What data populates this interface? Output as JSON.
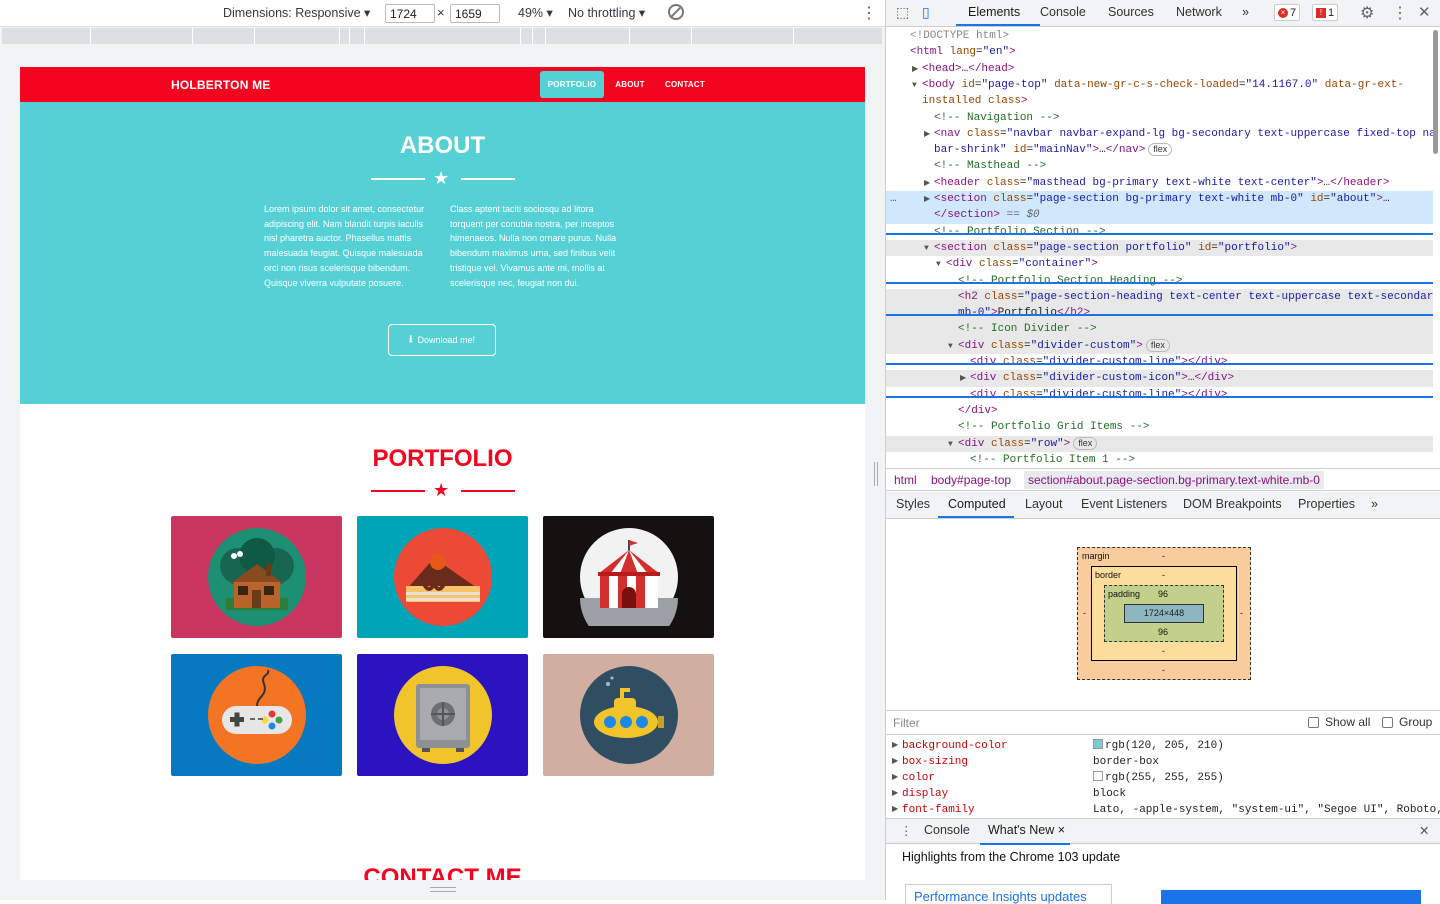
{
  "devbar": {
    "dimensions_label": "Dimensions: Responsive ▾",
    "width": "1724",
    "height": "1659",
    "times": "×",
    "zoom": "49% ▾",
    "throttle": "No throttling ▾",
    "more": "⋮"
  },
  "site": {
    "brand": "HOLBERTON ME",
    "nav": [
      "PORTFOLIO",
      "ABOUT",
      "CONTACT"
    ],
    "about_title": "ABOUT",
    "about_col1": "Lorem ipsum dolor sit amet, consectetur adipiscing elit. Nam blandit turpis iaculis nisl pharetra auctor. Phasellus mattis malesuada feugiat. Quisque malesuada orci non risus scelerisque bibendum. Quisque viverra vulputate posuere.",
    "about_col2": "Class aptent taciti sociosqu ad litora torquent per conubia nostra, per inceptos himenaeos. Nulla non ornare purus. Nulla bibendum maximus urna, sed finibus velit tristique vel. Vivamus ante mi, mollis at scelerisque nec, feugiat non dui.",
    "download_label": "Download me!",
    "portfolio_title": "PORTFOLIO",
    "contact_title": "CONTACT ME",
    "colors": {
      "red": "#f3041f",
      "teal": "#55d1d6"
    },
    "tiles": [
      {
        "name": "cabin",
        "bg": "#c9365f",
        "disc": "#1d8f73"
      },
      {
        "name": "cake",
        "bg": "#00a4b7",
        "disc": "#ec4a36"
      },
      {
        "name": "circus",
        "bg": "#151110",
        "disc": "#f2f2f2"
      },
      {
        "name": "game",
        "bg": "#0679c0",
        "disc": "#f37524"
      },
      {
        "name": "safe",
        "bg": "#2b13bf",
        "disc": "#f2c42b"
      },
      {
        "name": "submarine",
        "bg": "#d1afa0",
        "disc": "#2f4e62"
      }
    ]
  },
  "devtools": {
    "tabs": [
      "Elements",
      "Console",
      "Sources",
      "Network",
      "»"
    ],
    "errors": "7",
    "warnings": "1",
    "dom_lines": [
      {
        "i": 0,
        "html": "<span class='cmt' style='color:#888'>&lt;!DOCTYPE html&gt;</span>"
      },
      {
        "i": 0,
        "html": "<span class='tag'>&lt;html</span> <span class='attr'>lang</span>=<span class='val'>\"en\"</span><span class='tag'>&gt;</span>"
      },
      {
        "i": 1,
        "t": "▶",
        "html": "<span class='tag'>&lt;head&gt;</span>…<span class='tag'>&lt;/head&gt;</span>"
      },
      {
        "i": 1,
        "t": "▼",
        "html": "<span class='tag'>&lt;body</span> <span class='attr'>id</span>=<span class='val'>\"page-top\"</span> <span class='attr'>data-new-gr-c-s-check-loaded</span>=<span class='val'>\"14.1167.0\"</span> <span class='attr'>data-gr-ext-</span>"
      },
      {
        "i": 1,
        "html": "<span class='attr'>installed</span> <span class='attr'>class</span><span class='tag'>&gt;</span>"
      },
      {
        "i": 2,
        "html": "<span class='cmt'>&lt;!-- Navigation --&gt;</span>"
      },
      {
        "i": 2,
        "t": "▶",
        "html": "<span class='tag'>&lt;nav</span> <span class='attr'>class</span>=<span class='val'>\"navbar navbar-expand-lg bg-secondary text-uppercase fixed-top nav</span>"
      },
      {
        "i": 2,
        "html": "<span class='val'>bar-shrink\"</span> <span class='attr'>id</span>=<span class='val'>\"mainNav\"</span><span class='tag'>&gt;</span>…<span class='tag'>&lt;/nav&gt;</span><span class='pill'>flex</span>"
      },
      {
        "i": 2,
        "html": "<span class='cmt'>&lt;!-- Masthead --&gt;</span>"
      },
      {
        "i": 2,
        "t": "▶",
        "html": "<span class='tag'>&lt;header</span> <span class='attr'>class</span>=<span class='val'>\"masthead bg-primary text-white text-center\"</span><span class='tag'>&gt;</span>…<span class='tag'>&lt;/header&gt;</span>"
      },
      {
        "i": 2,
        "t": "▶",
        "hl": true,
        "html": "<span class='tag'>&lt;section</span> <span class='attr'>class</span>=<span class='val'>\"page-section bg-primary text-white mb-0\"</span> <span class='attr'>id</span>=<span class='val'>\"about\"</span><span class='tag'>&gt;</span>…"
      },
      {
        "i": 2,
        "hl": true,
        "html": "<span class='tag'>&lt;/section&gt;</span> <span style='color:#666'>== <i>$0</i></span>"
      },
      {
        "i": 2,
        "html": "<span class='cmt'>&lt;!-- Portfolio Section --&gt;</span>"
      },
      {
        "i": 2,
        "t": "▼",
        "gray": true,
        "html": "<span class='tag'>&lt;section</span> <span class='attr'>class</span>=<span class='val'>\"page-section portfolio\"</span> <span class='attr'>id</span>=<span class='val'>\"portfolio\"</span><span class='tag'>&gt;</span>"
      },
      {
        "i": 3,
        "t": "▼",
        "html": "<span class='tag'>&lt;div</span> <span class='attr'>class</span>=<span class='val'>\"container\"</span><span class='tag'>&gt;</span>"
      },
      {
        "i": 4,
        "html": "<span class='cmt'>&lt;!-- Portfolio Section Heading --&gt;</span>"
      },
      {
        "i": 4,
        "gray": true,
        "html": "<span class='tag'>&lt;h2</span> <span class='attr'>class</span>=<span class='val'>\"page-section-heading text-center text-uppercase text-secondary</span>"
      },
      {
        "i": 4,
        "gray": true,
        "html": "<span class='val'>mb-0\"</span><span class='tag'>&gt;</span><span class='txt'>Portfolio</span><span class='tag'>&lt;/h2&gt;</span>"
      },
      {
        "i": 4,
        "gray": true,
        "html": "<span class='cmt'>&lt;!-- Icon Divider --&gt;</span>"
      },
      {
        "i": 4,
        "t": "▼",
        "gray": true,
        "html": "<span class='tag'>&lt;div</span> <span class='attr'>class</span>=<span class='val'>\"divider-custom\"</span><span class='tag'>&gt;</span><span class='pill'>flex</span>"
      },
      {
        "i": 5,
        "html": "<span class='tag'>&lt;div</span> <span class='attr'>class</span>=<span class='val'>\"divider-custom-line\"</span><span class='tag'>&gt;&lt;/div&gt;</span>"
      },
      {
        "i": 5,
        "t": "▶",
        "gray": true,
        "html": "<span class='tag'>&lt;div</span> <span class='attr'>class</span>=<span class='val'>\"divider-custom-icon\"</span><span class='tag'>&gt;</span>…<span class='tag'>&lt;/div&gt;</span>"
      },
      {
        "i": 5,
        "html": "<span class='tag'>&lt;div</span> <span class='attr'>class</span>=<span class='val'>\"divider-custom-line\"</span><span class='tag'>&gt;&lt;/div&gt;</span>"
      },
      {
        "i": 4,
        "html": "<span class='tag'>&lt;/div&gt;</span>"
      },
      {
        "i": 4,
        "html": "<span class='cmt'>&lt;!-- Portfolio Grid Items --&gt;</span>"
      },
      {
        "i": 4,
        "t": "▼",
        "gray": true,
        "html": "<span class='tag'>&lt;div</span> <span class='attr'>class</span>=<span class='val'>\"row\"</span><span class='tag'>&gt;</span><span class='pill'>flex</span>"
      },
      {
        "i": 5,
        "html": "<span class='cmt'>&lt;!-- Portfolio Item 1 --&gt;</span>"
      }
    ],
    "crumbs": [
      "html",
      "body#page-top",
      "section#about.page-section.bg-primary.text-white.mb-0"
    ],
    "subtabs": [
      "Styles",
      "Computed",
      "Layout",
      "Event Listeners",
      "DOM Breakpoints",
      "Properties",
      "»"
    ],
    "boxmodel": {
      "margin_label": "margin",
      "border_label": "border",
      "padding_label": "padding",
      "margin_val": "-",
      "border_val": "-",
      "padding_top": "96",
      "padding_bottom": "96",
      "content": "1724×448",
      "dash": "-"
    },
    "filter": {
      "placeholder": "Filter",
      "show_all": "Show all",
      "group": "Group"
    },
    "props": [
      {
        "name": "background-color",
        "value": "rgb(120, 205, 210)",
        "swatch": "#78cdd2"
      },
      {
        "name": "box-sizing",
        "value": "border-box"
      },
      {
        "name": "color",
        "value": "rgb(255, 255, 255)",
        "swatch": "#ffffff"
      },
      {
        "name": "display",
        "value": "block"
      },
      {
        "name": "font-family",
        "value": "Lato, -apple-system, \"system-ui\", \"Segoe UI\", Roboto,"
      }
    ],
    "drawer": {
      "console": "Console",
      "whats_new": "What's New ×",
      "close": "✕"
    },
    "whats_new_title": "Highlights from the Chrome 103 update",
    "card_title": "Performance Insights updates"
  }
}
